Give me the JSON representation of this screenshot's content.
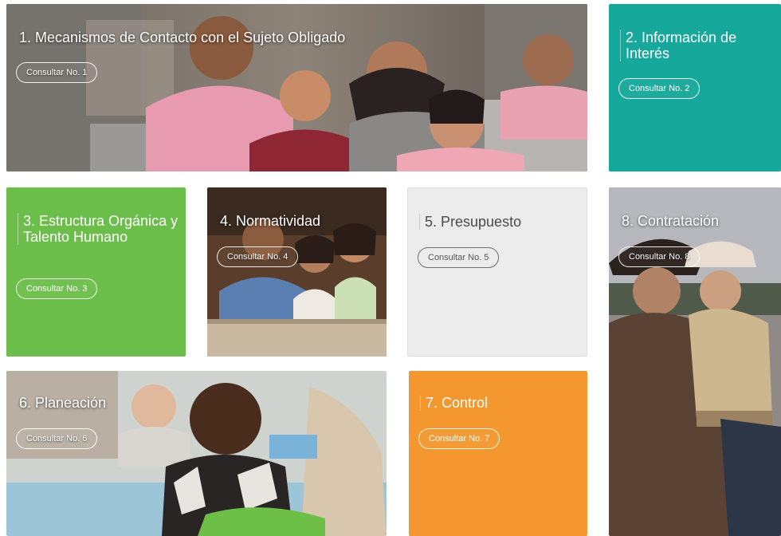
{
  "tiles": [
    {
      "title": "1. Mecanismos de Contacto con el Sujeto Obligado",
      "button": "Consultar No. 1"
    },
    {
      "title": "2. Información de Interés",
      "button": "Consultar No. 2"
    },
    {
      "title": "3. Estructura Orgánica y Talento Humano",
      "button": "Consultar No. 3"
    },
    {
      "title": "4. Normatividad",
      "button": "Consultar No. 4"
    },
    {
      "title": "5. Presupuesto",
      "button": "Consultar No. 5"
    },
    {
      "title": "8. Contratación",
      "button": "Consultar No. 8"
    },
    {
      "title": "6. Planeación",
      "button": "Consultar No. 6"
    },
    {
      "title": "7. Control",
      "button": "Consultar No. 7"
    }
  ],
  "colors": {
    "teal": "#15a89b",
    "green": "#6cbe4a",
    "light_gray": "#ececec",
    "orange": "#f3972e"
  }
}
